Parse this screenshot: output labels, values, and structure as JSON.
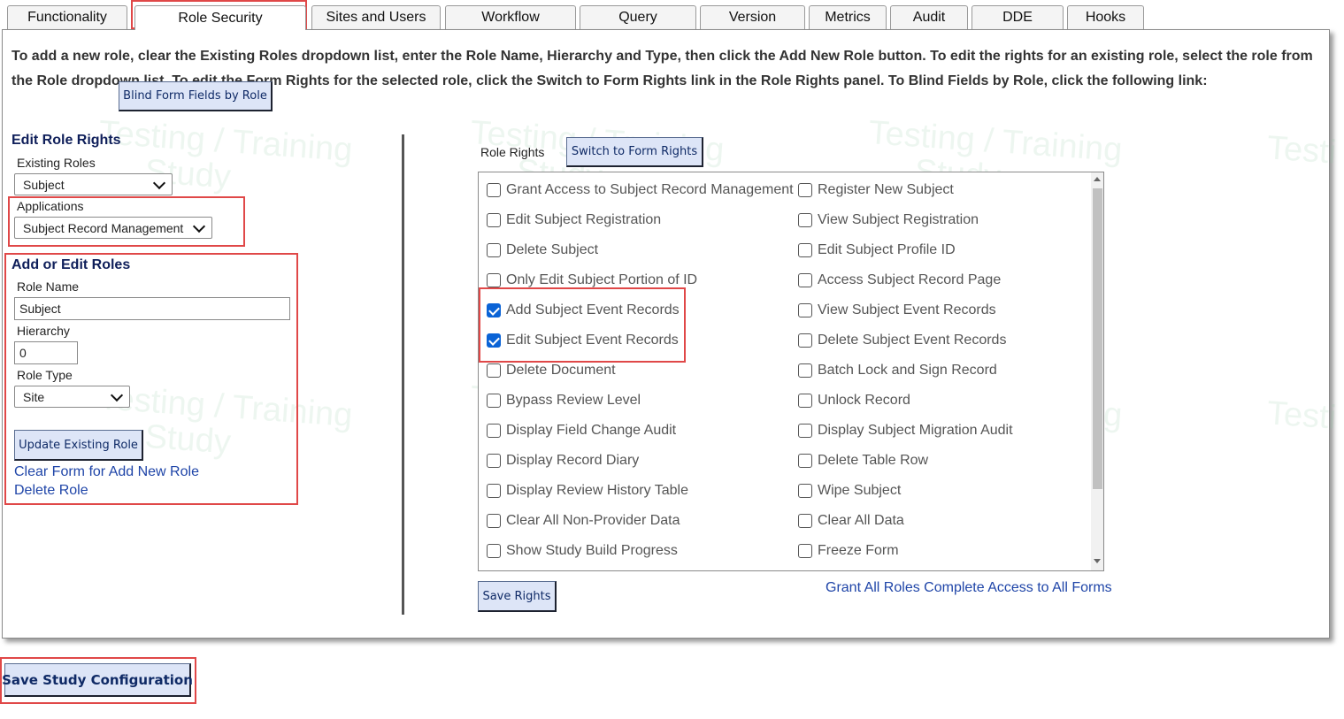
{
  "tabs": [
    {
      "label": "Functionality"
    },
    {
      "label": "Role Security"
    },
    {
      "label": "Sites and Users"
    },
    {
      "label": "Workflow"
    },
    {
      "label": "Query"
    },
    {
      "label": "Version"
    },
    {
      "label": "Metrics"
    },
    {
      "label": "Audit"
    },
    {
      "label": "DDE"
    },
    {
      "label": "Hooks"
    }
  ],
  "active_tab": "Role Security",
  "intro": {
    "text": "To add a new role, clear the Existing Roles dropdown list, enter the Role Name, Hierarchy and Type, then click the Add New Role button. To edit the rights for an existing role, select the role from the Role dropdown list. To edit the Form Rights for the selected role, click the Switch to Form Rights link in the Role Rights panel. To Blind Fields by Role, click the following link:",
    "blind_button": "Blind Form Fields by Role"
  },
  "edit_role_rights": {
    "heading": "Edit Role Rights",
    "existing_roles_label": "Existing Roles",
    "existing_roles_value": "Subject",
    "applications_label": "Applications",
    "applications_value": "Subject Record Management"
  },
  "add_edit_roles": {
    "heading": "Add or Edit Roles",
    "role_name_label": "Role Name",
    "role_name_value": "Subject",
    "hierarchy_label": "Hierarchy",
    "hierarchy_value": "0",
    "role_type_label": "Role Type",
    "role_type_value": "Site",
    "update_button": "Update Existing Role",
    "clear_link": "Clear Form for Add New Role",
    "delete_link": "Delete Role"
  },
  "role_rights": {
    "label": "Role Rights",
    "switch_button": "Switch to Form Rights",
    "left_column": [
      {
        "label": "Grant Access to Subject Record Management",
        "checked": false
      },
      {
        "label": "Edit Subject Registration",
        "checked": false
      },
      {
        "label": "Delete Subject",
        "checked": false
      },
      {
        "label": "Only Edit Subject Portion of ID",
        "checked": false
      },
      {
        "label": "Add Subject Event Records",
        "checked": true
      },
      {
        "label": "Edit Subject Event Records",
        "checked": true
      },
      {
        "label": "Delete Document",
        "checked": false
      },
      {
        "label": "Bypass Review Level",
        "checked": false
      },
      {
        "label": "Display Field Change Audit",
        "checked": false
      },
      {
        "label": "Display Record Diary",
        "checked": false
      },
      {
        "label": "Display Review History Table",
        "checked": false
      },
      {
        "label": "Clear All Non-Provider Data",
        "checked": false
      },
      {
        "label": "Show Study Build Progress",
        "checked": false
      }
    ],
    "right_column": [
      {
        "label": "Register New Subject",
        "checked": false
      },
      {
        "label": "View Subject Registration",
        "checked": false
      },
      {
        "label": "Edit Subject Profile ID",
        "checked": false
      },
      {
        "label": "Access Subject Record Page",
        "checked": false
      },
      {
        "label": "View Subject Event Records",
        "checked": false
      },
      {
        "label": "Delete Subject Event Records",
        "checked": false
      },
      {
        "label": "Batch Lock and Sign Record",
        "checked": false
      },
      {
        "label": "Unlock Record",
        "checked": false
      },
      {
        "label": "Display Subject Migration Audit",
        "checked": false
      },
      {
        "label": "Delete Table Row",
        "checked": false
      },
      {
        "label": "Wipe Subject",
        "checked": false
      },
      {
        "label": "Clear All Data",
        "checked": false
      },
      {
        "label": "Freeze Form",
        "checked": false
      }
    ],
    "save_button": "Save Rights",
    "grant_all_link": "Grant All Roles Complete Access to All Forms"
  },
  "watermark": {
    "line1": "Testing / Training",
    "line2": "Study",
    "fragment": "Testi"
  },
  "footer": {
    "save_config_button": "Save Study Configuration"
  },
  "colors": {
    "highlight_red": "#e04848",
    "link_blue": "#1f45a8",
    "checkbox_blue": "#0a63d6",
    "button_bg": "#dde5f7"
  }
}
